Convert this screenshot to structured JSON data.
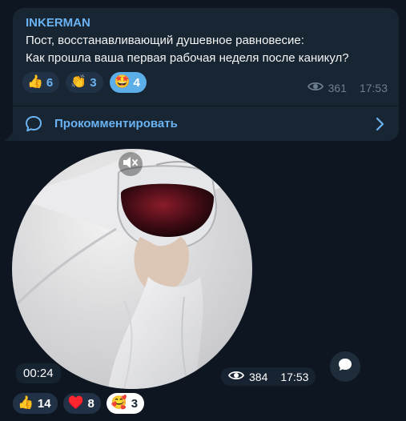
{
  "post": {
    "channel": "INKERMAN",
    "text": "Пост, восстанавливающий душевное равновесие:\nКак прошла ваша первая рабочая неделя после каникул?",
    "reactions": [
      {
        "emoji": "👍",
        "count": "6",
        "active": false
      },
      {
        "emoji": "👏",
        "count": "3",
        "active": false
      },
      {
        "emoji": "🤩",
        "count": "4",
        "active": true
      }
    ],
    "views": "361",
    "time": "17:53",
    "comment_label": "Прокомментировать"
  },
  "video_message": {
    "duration": "00:24",
    "views": "384",
    "time": "17:53",
    "reactions": [
      {
        "emoji": "👍",
        "count": "14",
        "active": false
      },
      {
        "emoji": "♥️",
        "count": "8",
        "active": false
      },
      {
        "emoji": "🥰",
        "count": "3",
        "active": true
      }
    ]
  },
  "icons": {
    "eye": "eye-icon",
    "comment": "comment-bubble-icon",
    "chevron": "chevron-right-icon",
    "mute": "speaker-muted-icon",
    "share": "share-bubble-icon"
  },
  "colors": {
    "background": "#0e1621",
    "bubble": "#182533",
    "accent": "#6ab3f3",
    "muted_text": "#6d7f8f"
  }
}
